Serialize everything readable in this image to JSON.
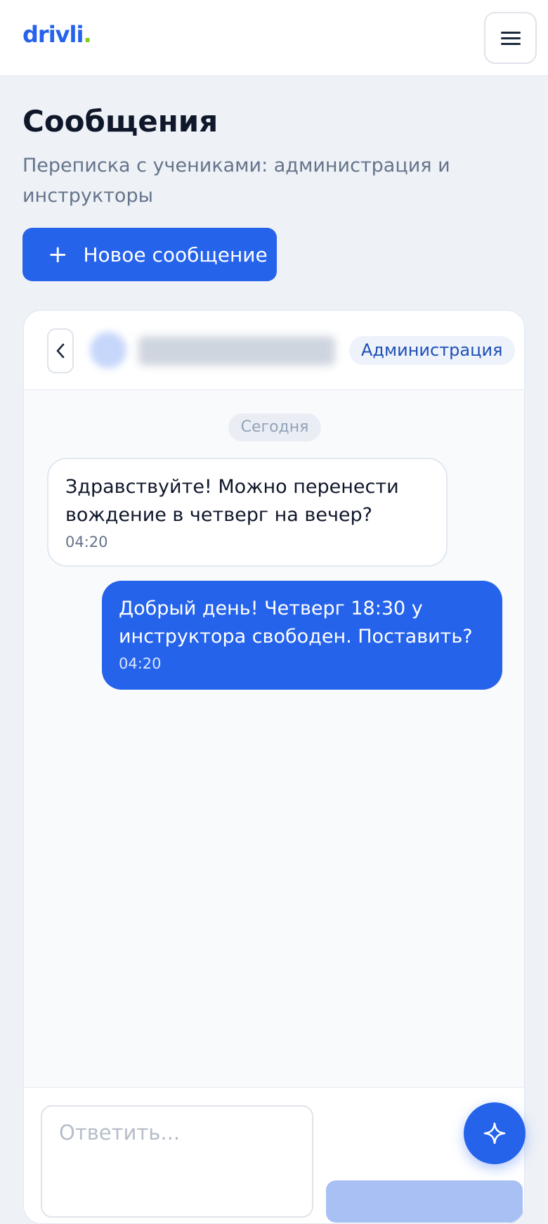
{
  "header": {
    "logo_text": "drivli",
    "logo_dot": ".",
    "brand_color": "#2563eb",
    "accent_color": "#84cc16",
    "menu_icon": "hamburger-menu-icon"
  },
  "page": {
    "title": "Сообщения",
    "subtitle": "Переписка с учениками: администрация и инструкторы",
    "new_message_button": "Новое сообщение",
    "new_message_icon": "plus-icon"
  },
  "conversation": {
    "back_icon": "chevron-left-icon",
    "contact_role": "Администрация",
    "date_divider": "Сегодня",
    "messages": [
      {
        "direction": "incoming",
        "text": "Здравствуйте! Можно перенести вождение в четверг на вечер?",
        "time": "04:20"
      },
      {
        "direction": "outgoing",
        "text": "Добрый день! Четверг 18:30 у инструктора свободен. Поставить?",
        "time": "04:20"
      }
    ],
    "reply_placeholder": "Ответить..."
  },
  "fab": {
    "icon": "sparkle-icon"
  }
}
